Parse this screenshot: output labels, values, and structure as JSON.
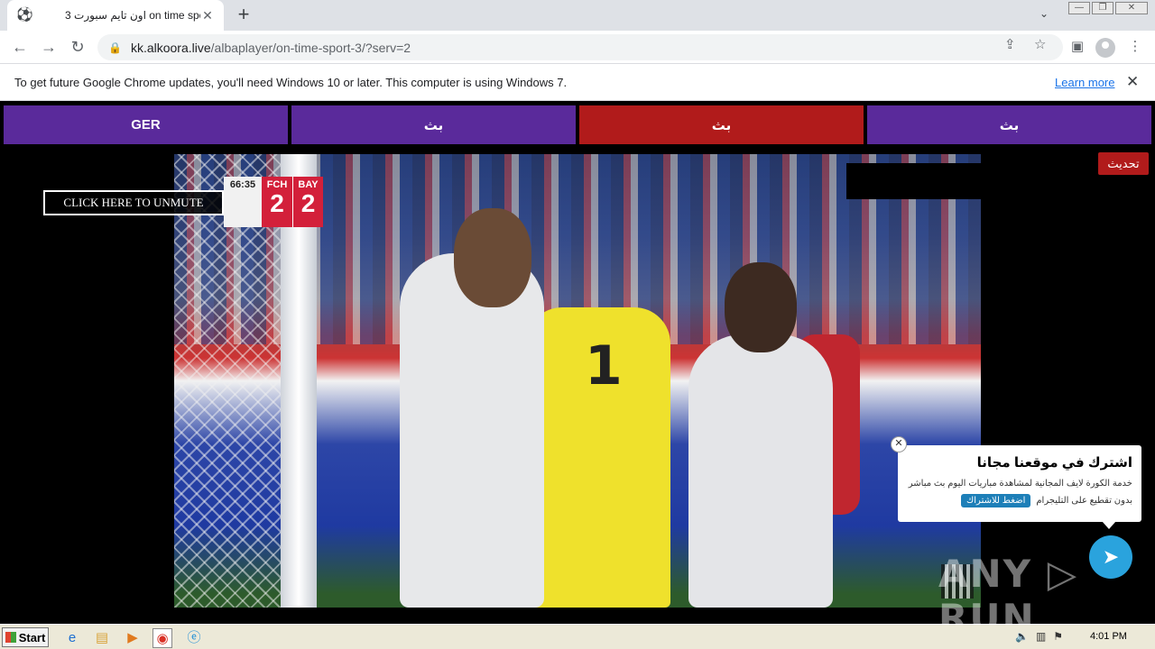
{
  "browser": {
    "tab": {
      "favicon": "soccer-ball-icon",
      "title": "اون تايم سبورت 3 on time sport",
      "close": "✕"
    },
    "new_tab": "+",
    "url_host": "kk.alkoora.live",
    "url_path": "/albaplayer/on-time-sport-3/?serv=2",
    "window_controls": [
      "—",
      "❐",
      "✕"
    ]
  },
  "infobar": {
    "message": "To get future Google Chrome updates, you'll need Windows 10 or later. This computer is using Windows 7.",
    "link": "Learn more",
    "close": "✕"
  },
  "servers": [
    {
      "label": "GER",
      "color": "#5a2a9b"
    },
    {
      "label": "بث",
      "color": "#5a2a9b"
    },
    {
      "label": "بث",
      "color": "#b11b1b"
    },
    {
      "label": "بث",
      "color": "#5a2a9b"
    }
  ],
  "refresh_label": "تحديث",
  "player": {
    "unmute_label": "CLICK HERE TO UNMUTE",
    "scorebug": {
      "clock": "66:35",
      "home": {
        "name": "FCH",
        "score": "2"
      },
      "away": {
        "name": "BAY",
        "score": "2"
      }
    },
    "keeper_number": "1"
  },
  "promo": {
    "title": "اشترك في موقعنا مجانا",
    "description": "خدمة الكورة لايف المجانية لمشاهدة مباريات اليوم بث مباشر",
    "sub": "بدون تقطيع على التليجرام",
    "button": "اضغط للاشتراك",
    "close": "✕"
  },
  "watermark": "ANY ▷ RUN",
  "taskbar": {
    "start": "Start",
    "clock": "4:01 PM"
  }
}
